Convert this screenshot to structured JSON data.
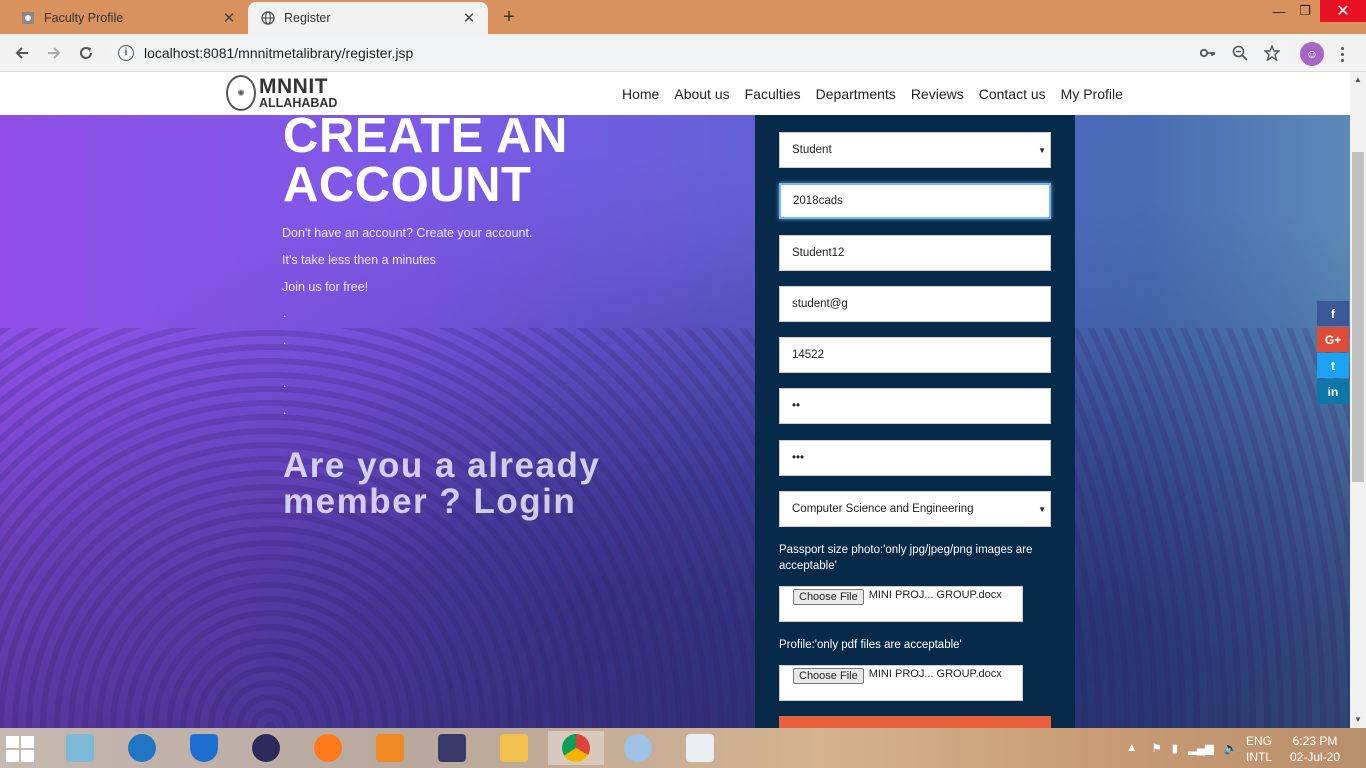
{
  "browser": {
    "tabs": [
      {
        "title": "Faculty Profile",
        "icon": "faculty-favicon"
      },
      {
        "title": "Register",
        "icon": "globe-icon"
      }
    ],
    "new_tab_symbol": "+",
    "close_symbol": "✕",
    "url": "localhost:8081/mnnitmetalibrary/register.jsp",
    "window_controls": {
      "minimize": "—",
      "maximize": "❐",
      "close": "✕"
    }
  },
  "site": {
    "logo": {
      "line1": "MNNIT",
      "line2": "ALLAHABAD"
    },
    "nav": [
      "Home",
      "About us",
      "Faculties",
      "Departments",
      "Reviews",
      "Contact us",
      "My Profile"
    ]
  },
  "hero": {
    "title_line1": "CREATE AN",
    "title_line2": "ACCOUNT",
    "lines": [
      "Don't have an account? Create your account.",
      "It's take less then a minutes",
      "Join us for free!"
    ],
    "dots": [
      ".",
      ".",
      ".",
      "."
    ],
    "login_line1": "Are you a already",
    "login_line2": "member ? Login"
  },
  "form": {
    "role_select": "Student",
    "reg_no": "2018cads",
    "username": "Student12",
    "email": "student@g",
    "phone": "14522",
    "password_mask": "••",
    "confirm_mask": "•••",
    "department_select": "Computer Science and Engineering",
    "photo_label": "Passport size photo:'only jpg/jpeg/png images are acceptable'",
    "photo_button": "Choose File",
    "photo_file": "MINI   PROJ... GROUP.docx",
    "profile_label": "Profile:'only pdf files are acceptable'",
    "profile_button": "Choose File",
    "profile_file": "MINI   PROJ... GROUP.docx",
    "select_caret": "▼"
  },
  "social": [
    "f",
    "G+",
    "t",
    "in"
  ],
  "taskbar": {
    "lang_line1": "ENG",
    "lang_line2": "INTL",
    "time": "6:23 PM",
    "date": "02-Jul-20"
  },
  "colors": {
    "tabbar": "#d9925e",
    "form_panel": "#082a4a",
    "submit": "#e8603c"
  }
}
